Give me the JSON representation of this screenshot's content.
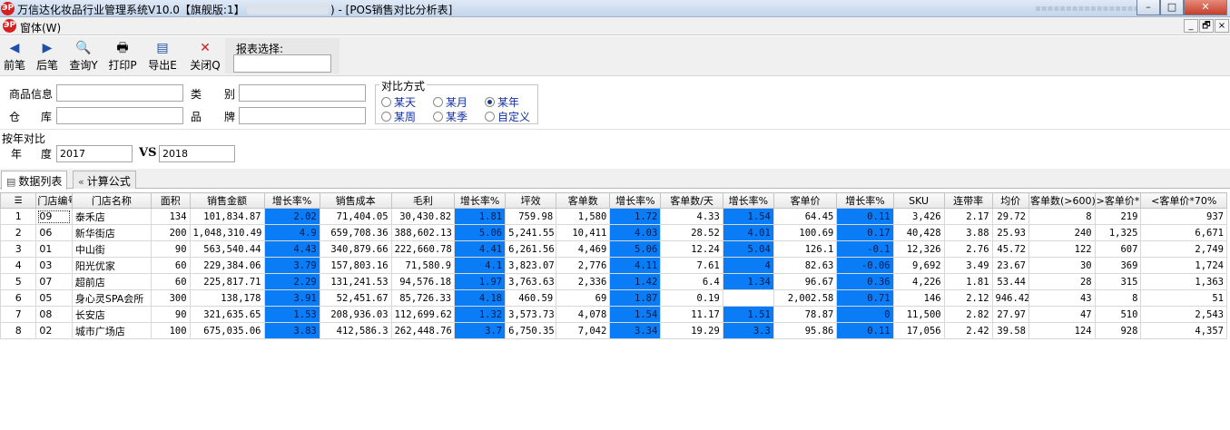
{
  "window": {
    "title_left": "万信达化妆品行业管理系统V10.0【旗舰版:1】",
    "title_right": ") - [POS销售对比分析表]",
    "title_icon": "app-logo-icon",
    "controls": [
      "–",
      "□",
      "✕"
    ]
  },
  "menubar": {
    "item": "窗体(W)",
    "mdi_controls": [
      "_",
      "🗗",
      "×"
    ]
  },
  "toolbar": {
    "buttons": [
      {
        "label": "前笔",
        "icon": "arrow-left-icon"
      },
      {
        "label": "后笔",
        "icon": "arrow-right-icon"
      },
      {
        "label": "查询Y",
        "icon": "magnifier-icon"
      },
      {
        "label": "打印P",
        "icon": "printer-icon"
      },
      {
        "label": "导出E",
        "icon": "export-folder-icon"
      },
      {
        "label": "关闭Q",
        "icon": "close-x-icon"
      }
    ],
    "report_label": "报表选择:",
    "report_value": ""
  },
  "filters": {
    "product_label": "商品信息",
    "product_value": "",
    "category_label_1": "类",
    "category_label_2": "别",
    "category_value": "",
    "warehouse_label_1": "仓",
    "warehouse_label_2": "库",
    "warehouse_value": "",
    "brand_label_1": "品",
    "brand_label_2": "牌",
    "brand_value": "",
    "compare_title": "对比方式",
    "compare_options": [
      "某天",
      "某月",
      "某年",
      "某周",
      "某季",
      "自定义"
    ],
    "compare_selected": "某年"
  },
  "year_compare": {
    "title": "按年对比",
    "label_1": "年",
    "label_2": "度",
    "year_a": "2017",
    "vs": "VS",
    "year_b": "2018"
  },
  "tabs": [
    {
      "label": "数据列表",
      "icon": "list-icon",
      "active": true
    },
    {
      "label": "计算公式",
      "icon": "double-chevron-icon",
      "active": false
    }
  ],
  "grid": {
    "highlight_color": "#0a7cf5",
    "headers": [
      "门店编号",
      "门店名称",
      "面积",
      "销售金额",
      "增长率%",
      "销售成本",
      "毛利",
      "增长率%",
      "坪效",
      "客单数",
      "增长率%",
      "客单数/天",
      "增长率%",
      "客单价",
      "增长率%",
      "SKU",
      "连带率",
      "均价",
      "客单数(>600)",
      ">客单价*2",
      "<客单价*70%"
    ],
    "rows": [
      [
        "1",
        "09",
        "泰禾店",
        "134",
        "101,834.87",
        "2.02",
        "71,404.05",
        "30,430.82",
        "1.81",
        "759.98",
        "1,580",
        "1.72",
        "4.33",
        "1.54",
        "64.45",
        "0.11",
        "3,426",
        "2.17",
        "29.72",
        "8",
        "219",
        "937"
      ],
      [
        "2",
        "06",
        "新华街店",
        "200",
        "1,048,310.49",
        "4.9",
        "659,708.36",
        "388,602.13",
        "5.06",
        "5,241.55",
        "10,411",
        "4.03",
        "28.52",
        "4.01",
        "100.69",
        "0.17",
        "40,428",
        "3.88",
        "25.93",
        "240",
        "1,325",
        "6,671"
      ],
      [
        "3",
        "01",
        "中山街",
        "90",
        "563,540.44",
        "4.43",
        "340,879.66",
        "222,660.78",
        "4.41",
        "6,261.56",
        "4,469",
        "5.06",
        "12.24",
        "5.04",
        "126.1",
        "-0.1",
        "12,326",
        "2.76",
        "45.72",
        "122",
        "607",
        "2,749"
      ],
      [
        "4",
        "03",
        "阳光优家",
        "60",
        "229,384.06",
        "3.79",
        "157,803.16",
        "71,580.9",
        "4.1",
        "3,823.07",
        "2,776",
        "4.11",
        "7.61",
        "4",
        "82.63",
        "-0.06",
        "9,692",
        "3.49",
        "23.67",
        "30",
        "369",
        "1,724"
      ],
      [
        "5",
        "07",
        "超前店",
        "60",
        "225,817.71",
        "2.29",
        "131,241.53",
        "94,576.18",
        "1.97",
        "3,763.63",
        "2,336",
        "1.42",
        "6.4",
        "1.34",
        "96.67",
        "0.36",
        "4,226",
        "1.81",
        "53.44",
        "28",
        "315",
        "1,363"
      ],
      [
        "6",
        "05",
        "身心灵SPA会所",
        "300",
        "138,178",
        "3.91",
        "52,451.67",
        "85,726.33",
        "4.18",
        "460.59",
        "69",
        "1.87",
        "0.19",
        "",
        "2,002.58",
        "0.71",
        "146",
        "2.12",
        "946.42",
        "43",
        "8",
        "51"
      ],
      [
        "7",
        "08",
        "长安店",
        "90",
        "321,635.65",
        "1.53",
        "208,936.03",
        "112,699.62",
        "1.32",
        "3,573.73",
        "4,078",
        "1.54",
        "11.17",
        "1.51",
        "78.87",
        "0",
        "11,500",
        "2.82",
        "27.97",
        "47",
        "510",
        "2,543"
      ],
      [
        "8",
        "02",
        "城市广场店",
        "100",
        "675,035.06",
        "3.83",
        "412,586.3",
        "262,448.76",
        "3.7",
        "6,750.35",
        "7,042",
        "3.34",
        "19.29",
        "3.3",
        "95.86",
        "0.11",
        "17,056",
        "2.42",
        "39.58",
        "124",
        "928",
        "4,357"
      ]
    ]
  }
}
